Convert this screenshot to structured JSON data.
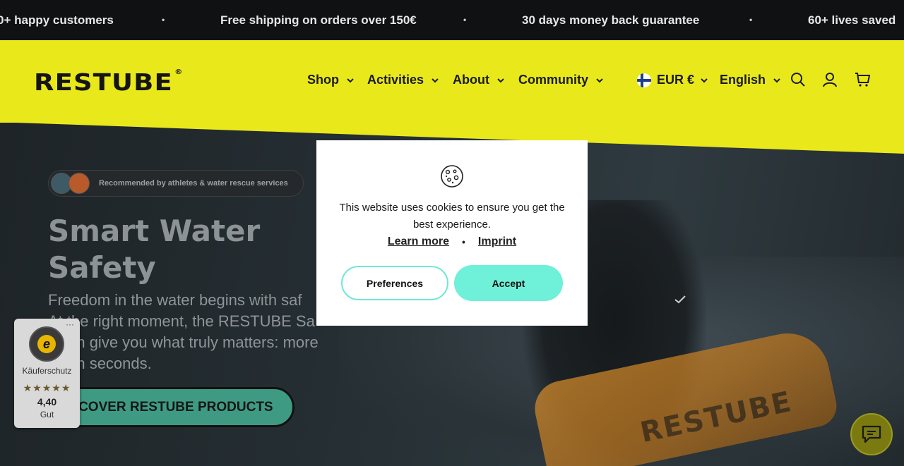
{
  "announcement": {
    "items": [
      "0+ happy customers",
      "Free shipping on orders over 150€",
      "30 days money back guarantee",
      "60+ lives saved"
    ],
    "separator": "•"
  },
  "header": {
    "logo": "RESTUBE",
    "logo_mark": "®",
    "nav": [
      "Shop",
      "Activities",
      "About",
      "Community"
    ],
    "currency": "EUR €",
    "language": "English",
    "icons": [
      "search-icon",
      "account-icon",
      "cart-icon"
    ]
  },
  "hero": {
    "badge": "Recommended by athletes & water rescue services",
    "title": "Smart Water Safety",
    "text": "Freedom in the water begins with safety. At the right moment, the RESTUBE Safety Buoy can give you what truly matters: more safety in seconds.",
    "text_lines": [
      "Freedom in the water begins with saf",
      "At the right moment, the RESTUBE Sa",
      "y can give you what truly matters: more",
      "ety in seconds."
    ],
    "cta": "SCOVER RESTUBE PRODUCTS",
    "buoy_text": "RESTUBE"
  },
  "trust": {
    "label": "Käuferschutz",
    "stars": "★★★★★",
    "score": "4,40",
    "grade": "Gut",
    "more": "···"
  },
  "cookie": {
    "message": "This website uses cookies to ensure you get the best experience.",
    "learn_more": "Learn more",
    "imprint": "Imprint",
    "separator": "•",
    "preferences": "Preferences",
    "accept": "Accept"
  },
  "colors": {
    "brand_yellow": "#e9e81b",
    "accent_teal": "#6ff0d8",
    "announce_bg": "#0f1112"
  }
}
